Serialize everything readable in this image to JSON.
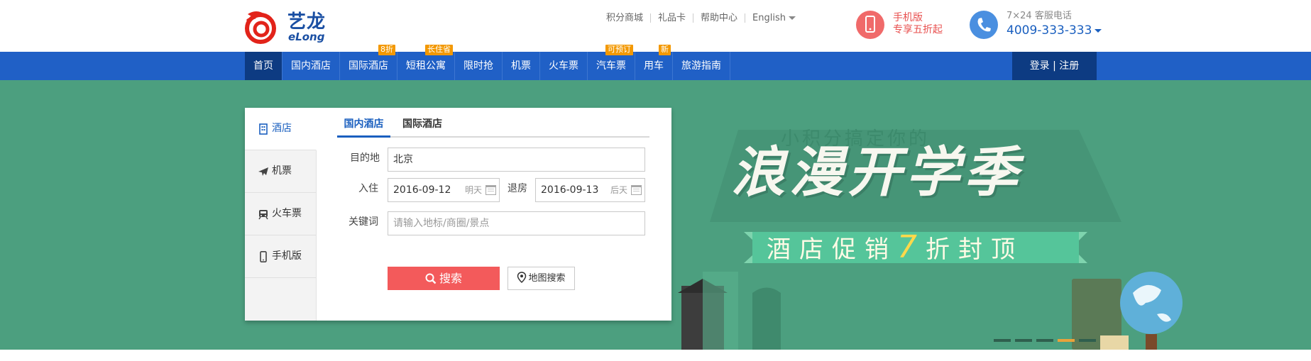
{
  "header": {
    "logo_cn": "艺龙",
    "logo_en": "eLong",
    "top_links": [
      "积分商城",
      "礼品卡",
      "帮助中心",
      "English"
    ],
    "mobile_promo": {
      "line1": "手机版",
      "line2": "专享五折起",
      "icon": "phone-icon"
    },
    "service": {
      "line1": "7×24 客服电话",
      "phone": "4009-333-333",
      "icon": "telephone-icon"
    }
  },
  "nav": {
    "items": [
      {
        "label": "首页",
        "badge": ""
      },
      {
        "label": "国内酒店",
        "badge": ""
      },
      {
        "label": "国际酒店",
        "badge": "8折"
      },
      {
        "label": "短租公寓",
        "badge": "长住省"
      },
      {
        "label": "限时抢",
        "badge": ""
      },
      {
        "label": "机票",
        "badge": ""
      },
      {
        "label": "火车票",
        "badge": ""
      },
      {
        "label": "汽车票",
        "badge": "可预订"
      },
      {
        "label": "用车",
        "badge": "新"
      },
      {
        "label": "旅游指南",
        "badge": ""
      }
    ],
    "login": "登录 | 注册"
  },
  "search": {
    "side": [
      {
        "label": "酒店",
        "icon": "building-icon"
      },
      {
        "label": "机票",
        "icon": "plane-icon"
      },
      {
        "label": "火车票",
        "icon": "train-icon"
      },
      {
        "label": "手机版",
        "icon": "mobile-icon"
      }
    ],
    "tabs": [
      "国内酒店",
      "国际酒店"
    ],
    "destination": {
      "label": "目的地",
      "value": "北京"
    },
    "checkin": {
      "label": "入住",
      "value": "2016-09-12",
      "hint": "明天"
    },
    "checkout": {
      "label": "退房",
      "value": "2016-09-13",
      "hint": "后天"
    },
    "keyword": {
      "label": "关键词",
      "placeholder": "请输入地标/商圈/景点"
    },
    "search_button": "搜索",
    "map_button": "地图搜索"
  },
  "banner": {
    "ghost_text": "小积分搞定你的",
    "title": "浪漫开学季",
    "ribbon_before": "酒店促销",
    "ribbon_number": "7",
    "ribbon_after": "折封顶",
    "slides": 5,
    "active_slide": 4,
    "colors": {
      "background": "#4c9f7f",
      "ribbon": "#55c59a",
      "accent": "#ffd94a"
    }
  },
  "colors": {
    "nav": "#2060c6",
    "nav_dark": "#0d3b82",
    "search_button": "#f35a5b",
    "link_blue": "#1a5fbf"
  }
}
